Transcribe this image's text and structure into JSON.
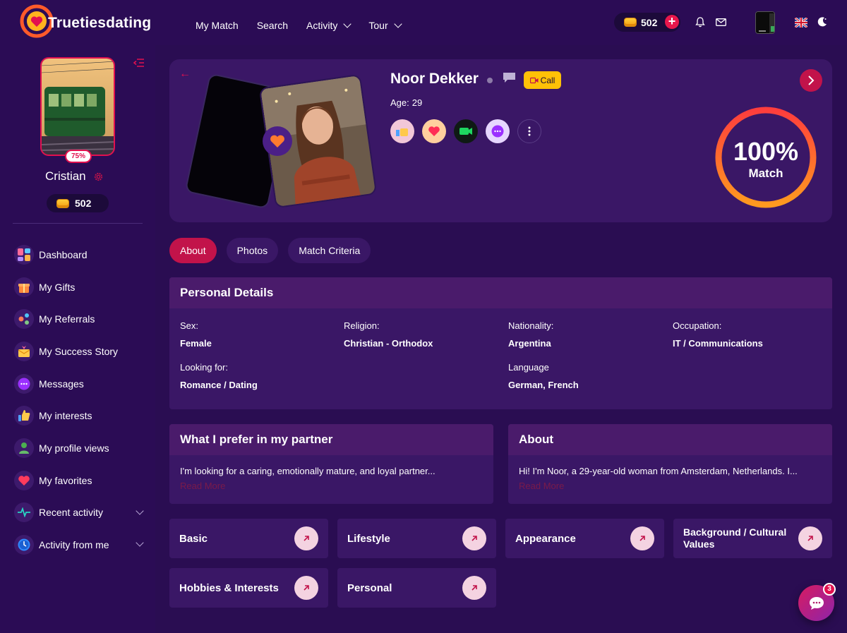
{
  "brand": {
    "name": "Truetiesdating",
    "accent": "#c2134a",
    "background": "#2a0d52"
  },
  "nav": {
    "items": [
      {
        "label": "My Match",
        "dropdown": false
      },
      {
        "label": "Search",
        "dropdown": false
      },
      {
        "label": "Activity",
        "dropdown": true
      },
      {
        "label": "Tour",
        "dropdown": true
      }
    ],
    "coins": "502",
    "icons": [
      "coin-icon",
      "plus-icon",
      "bell-icon",
      "mail-icon",
      "uk-flag-icon",
      "moon-icon"
    ]
  },
  "sidebar": {
    "user_name": "Cristian",
    "profile_completion": "75%",
    "coins": "502",
    "items": [
      {
        "label": "Dashboard",
        "icon": "dashboard-icon",
        "expandable": false
      },
      {
        "label": "My Gifts",
        "icon": "gift-icon",
        "expandable": false
      },
      {
        "label": "My Referrals",
        "icon": "referrals-icon",
        "expandable": false
      },
      {
        "label": "My Success Story",
        "icon": "success-story-icon",
        "expandable": false
      },
      {
        "label": "Messages",
        "icon": "messages-icon",
        "expandable": false
      },
      {
        "label": "My interests",
        "icon": "thumbs-up-icon",
        "expandable": false
      },
      {
        "label": "My profile views",
        "icon": "person-icon",
        "expandable": false
      },
      {
        "label": "My favorites",
        "icon": "heart-icon",
        "expandable": false
      },
      {
        "label": "Recent activity",
        "icon": "pulse-icon",
        "expandable": true
      },
      {
        "label": "Activity from me",
        "icon": "clock-icon",
        "expandable": true
      }
    ]
  },
  "match": {
    "name": "Noor Dekker",
    "age_label": "Age:",
    "age": "29",
    "call_label": "Call",
    "match_percent": "100%",
    "match_label": "Match",
    "actions": [
      "like-icon",
      "heart-icon",
      "video-call-icon",
      "chat-icon",
      "more-icon"
    ]
  },
  "tabs": [
    {
      "label": "About",
      "active": true
    },
    {
      "label": "Photos",
      "active": false
    },
    {
      "label": "Match Criteria",
      "active": false
    }
  ],
  "personal_details": {
    "title": "Personal Details",
    "fields": [
      {
        "label": "Sex:",
        "value": "Female"
      },
      {
        "label": "Religion:",
        "value": "Christian - Orthodox"
      },
      {
        "label": "Nationality:",
        "value": "Argentina"
      },
      {
        "label": "Occupation:",
        "value": "IT / Communications"
      },
      {
        "label": "Looking for:",
        "value": "Romance / Dating"
      },
      {
        "label": "Language",
        "value": "German, French"
      }
    ]
  },
  "partner_pref": {
    "title": "What I prefer in my partner",
    "text": "I'm looking for a caring, emotionally mature, and loyal partner...",
    "read_more": "Read More"
  },
  "about": {
    "title": "About",
    "text": "Hi! I'm Noor, a 29-year-old woman from Amsterdam, Netherlands. I...",
    "read_more": "Read More"
  },
  "sections": [
    {
      "label": "Basic"
    },
    {
      "label": "Lifestyle"
    },
    {
      "label": "Appearance"
    },
    {
      "label": "Background / Cultural Values"
    },
    {
      "label": "Hobbies & Interests"
    },
    {
      "label": "Personal"
    }
  ],
  "chat_fab": {
    "badge": "3"
  }
}
